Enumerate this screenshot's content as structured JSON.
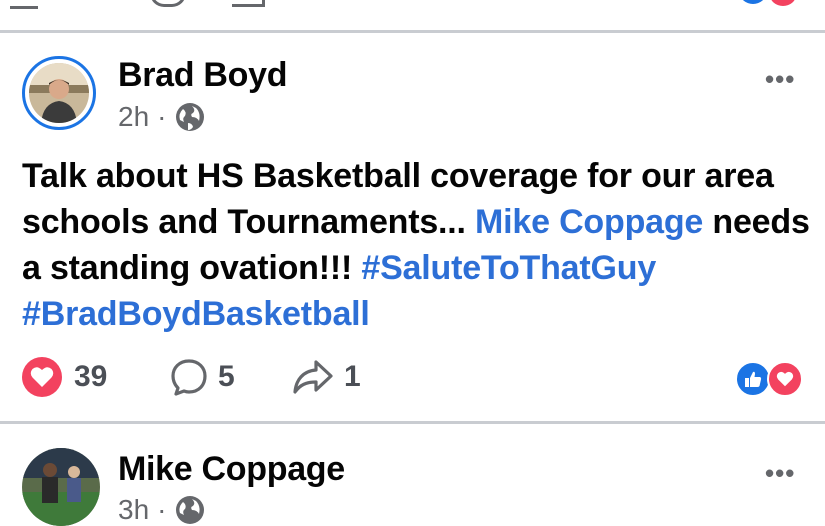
{
  "post": {
    "author": "Brad Boyd",
    "time": "2h",
    "separator": "·",
    "privacy_icon": "globe-icon",
    "text_segments": [
      {
        "text": "Talk about HS Basketball coverage for our area schools and Tournaments... ",
        "link": false
      },
      {
        "text": "Mike Coppage",
        "link": true
      },
      {
        "text": " needs a standing ovation!!! ",
        "link": false
      },
      {
        "text": "#SaluteToThatGuy",
        "link": true
      },
      {
        "text": " ",
        "link": false
      },
      {
        "text": "#BradBoydBasketball",
        "link": true
      }
    ],
    "reactions_count": "39",
    "comments_count": "5",
    "shares_count": "1",
    "more_label": "•••"
  },
  "next_post": {
    "author": "Mike Coppage",
    "time": "3h",
    "separator": "·",
    "more_label": "•••"
  },
  "colors": {
    "link": "#2d6fd6",
    "like_blue": "#1b74e4",
    "love_red": "#f3425f",
    "meta_gray": "#65676b"
  }
}
